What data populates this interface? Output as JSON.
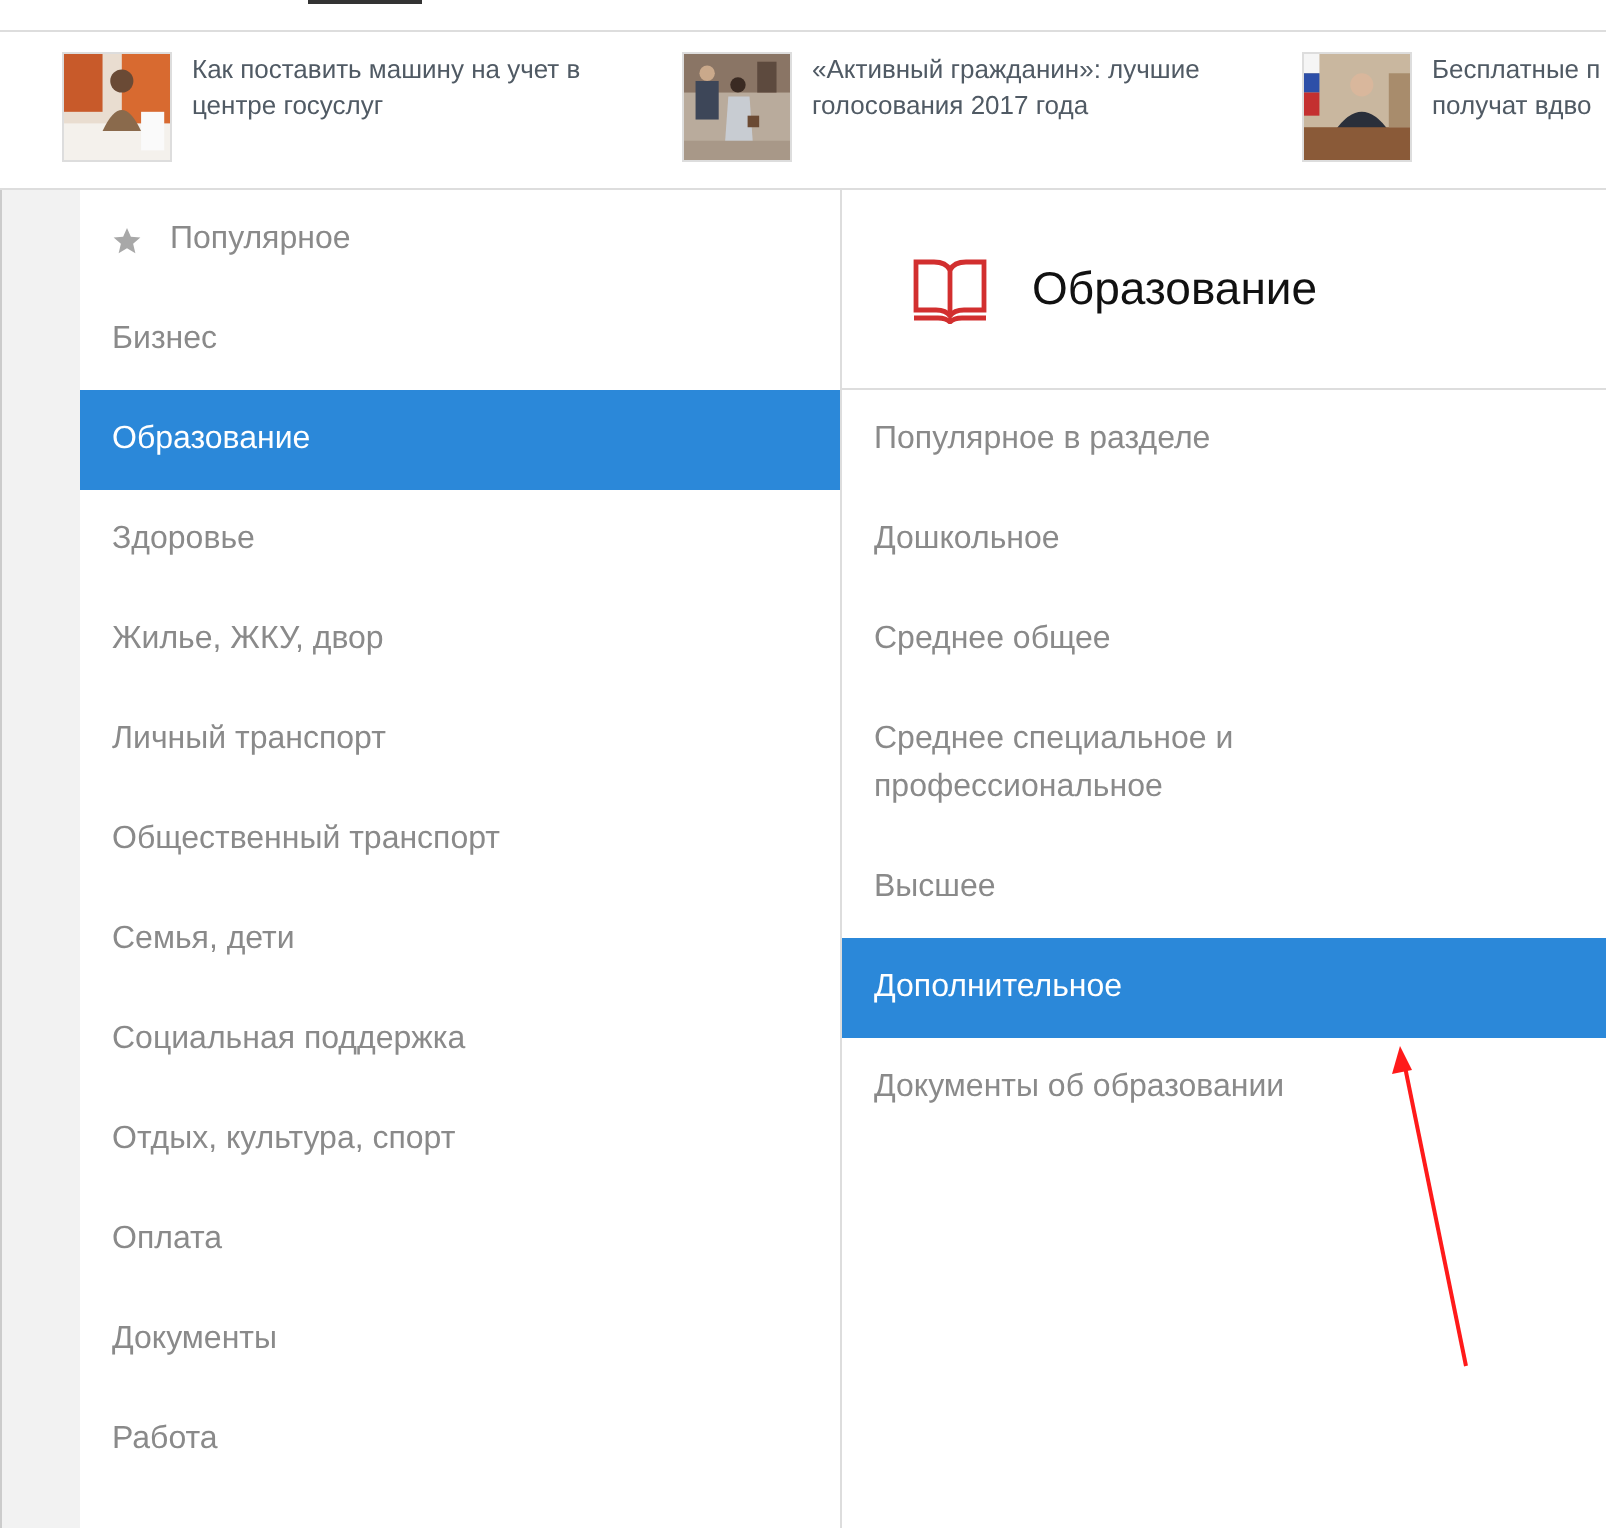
{
  "news": [
    {
      "lines": [
        "Как поставить машину на учет в",
        "центре госуслуг"
      ],
      "picture": {
        "kind": "picture"
      }
    },
    {
      "lines": [
        "«Активный гражданин»: лучшие",
        "голосования 2017 года"
      ],
      "picture": {
        "kind": "picture"
      }
    },
    {
      "lines": [
        "Бесплатные п",
        "получат вдво"
      ],
      "picture": {
        "kind": "picture"
      }
    }
  ],
  "categories": [
    {
      "label": "Популярное",
      "kind": "starred",
      "selected": false
    },
    {
      "label": "Бизнес",
      "kind": "plain",
      "selected": false
    },
    {
      "label": "Образование",
      "kind": "plain",
      "selected": true
    },
    {
      "label": "Здоровье",
      "kind": "plain",
      "selected": false
    },
    {
      "label": "Жилье, ЖКУ, двор",
      "kind": "plain",
      "selected": false
    },
    {
      "label": "Личный транспорт",
      "kind": "plain",
      "selected": false
    },
    {
      "label": "Общественный транспорт",
      "kind": "plain",
      "selected": false
    },
    {
      "label": "Семья, дети",
      "kind": "plain",
      "selected": false
    },
    {
      "label": "Социальная поддержка",
      "kind": "plain",
      "selected": false
    },
    {
      "label": "Отдых, культура, спорт",
      "kind": "plain",
      "selected": false
    },
    {
      "label": "Оплата",
      "kind": "plain",
      "selected": false
    },
    {
      "label": "Документы",
      "kind": "plain",
      "selected": false
    },
    {
      "label": "Работа",
      "kind": "plain",
      "selected": false
    }
  ],
  "section": {
    "title": "Образование",
    "items": [
      {
        "label": "Популярное в разделе",
        "selected": false
      },
      {
        "label": "Дошкольное",
        "selected": false
      },
      {
        "label": "Среднее общее",
        "selected": false
      },
      {
        "label": "Среднее специальное и профессиональное",
        "selected": false
      },
      {
        "label": "Высшее",
        "selected": false
      },
      {
        "label": "Дополнительное",
        "selected": true
      },
      {
        "label": "Документы об образовании",
        "selected": false
      }
    ]
  }
}
